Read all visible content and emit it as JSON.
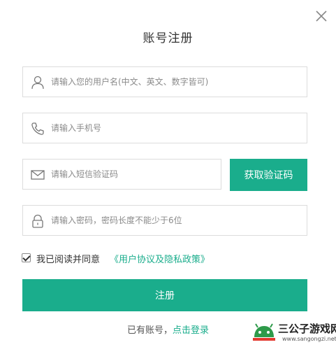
{
  "dialog": {
    "title": "账号注册",
    "close_icon": "close-icon"
  },
  "form": {
    "username": {
      "placeholder": "请输入您的用户名(中文、英文、数字皆可)",
      "icon": "user-icon"
    },
    "phone": {
      "placeholder": "请输入手机号",
      "icon": "phone-icon"
    },
    "sms_code": {
      "placeholder": "请输入短信验证码",
      "icon": "mail-icon"
    },
    "get_code_label": "获取验证码",
    "password": {
      "placeholder": "请输入密码，密码长度不能少于6位",
      "icon": "lock-icon"
    },
    "agree": {
      "checked": true,
      "text": "我已阅读并同意",
      "link": "《用户协议及隐私政策》"
    },
    "submit_label": "注册"
  },
  "footer": {
    "has_account": "已有账号，",
    "login_link": "点击登录"
  },
  "watermark": {
    "name": "三公子游戏网",
    "url": "www.sangongzi.net"
  },
  "colors": {
    "accent": "#1aad8c",
    "border": "#dcdcdc",
    "placeholder": "#8a8a8a"
  }
}
